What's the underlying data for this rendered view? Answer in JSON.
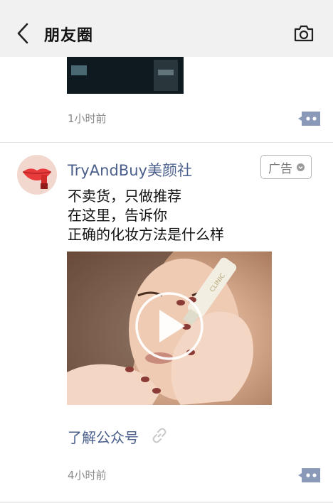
{
  "header": {
    "title": "朋友圈"
  },
  "previous_post": {
    "time": "1小时前"
  },
  "ad_post": {
    "author": "TryAndBuy美颜社",
    "ad_label": "广告",
    "lines": [
      "不卖货，只做推荐",
      "在这里，告诉你",
      "正确的化妆方法是什么样"
    ],
    "link_label": "了解公众号",
    "time": "4小时前"
  },
  "colors": {
    "header_bg": "#f1f1f1",
    "link_blue": "#4a5f8c",
    "time_gray": "#8a8a8a",
    "comment_icon": "#8b99b8",
    "avatar_lips": "#e83a3a"
  },
  "icons": [
    "back-arrow-icon",
    "camera-icon",
    "comment-icon",
    "play-icon",
    "link-icon",
    "chevron-down-icon"
  ]
}
